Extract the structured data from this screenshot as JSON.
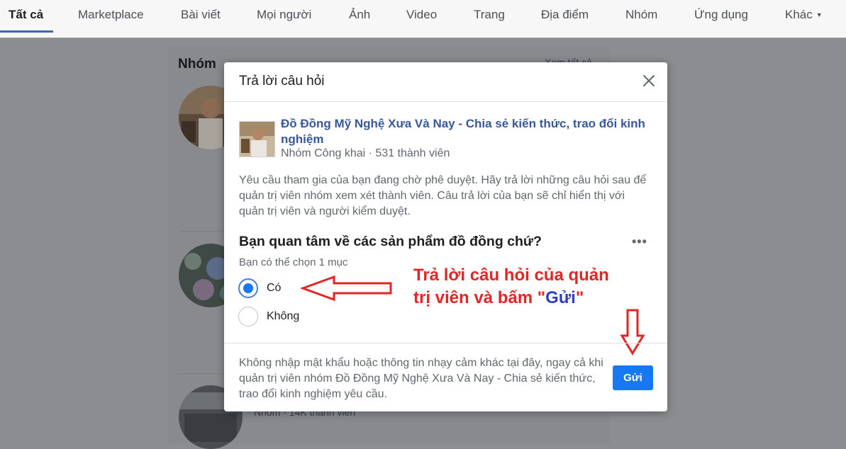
{
  "tabs": [
    {
      "label": "Tất cả",
      "active": true
    },
    {
      "label": "Marketplace"
    },
    {
      "label": "Bài viết"
    },
    {
      "label": "Mọi người"
    },
    {
      "label": "Ảnh"
    },
    {
      "label": "Video"
    },
    {
      "label": "Trang"
    },
    {
      "label": "Địa điểm"
    },
    {
      "label": "Nhóm"
    },
    {
      "label": "Ứng dụng"
    },
    {
      "label": "Khác"
    }
  ],
  "background": {
    "section_title": "Nhóm",
    "see_all": "Xem tất cả",
    "item3_meta": "Nhóm · 14K thành viên"
  },
  "dialog": {
    "title": "Trả lời câu hỏi",
    "group_name": "Đồ Đồng Mỹ Nghệ Xưa Và Nay - Chia sẻ kiến thức, trao đổi kinh nghiệm",
    "group_meta": "Nhóm Công khai · 531 thành viên",
    "notice": "Yêu cầu tham gia của bạn đang chờ phê duyệt. Hãy trả lời những câu hỏi sau để quản trị viên nhóm xem xét thành viên. Câu trả lời của bạn sẽ chỉ hiển thị với quản trị viên và người kiểm duyệt.",
    "question": "Bạn quan tâm về các sản phẩm đồ đồng chứ?",
    "hint": "Bạn có thể chọn 1 mục",
    "options": [
      {
        "label": "Có",
        "selected": true
      },
      {
        "label": "Không",
        "selected": false
      }
    ],
    "footer_text": "Không nhập mật khẩu hoặc thông tin nhạy cảm khác tại đây, ngay cả khi quản trị viên nhóm Đồ Đồng Mỹ Nghệ Xưa Và Nay - Chia sẻ kiến thức, trao đổi kinh nghiệm yêu cầu.",
    "send_label": "Gửi"
  },
  "annotation": {
    "line1": "Trả lời câu hỏi của quản",
    "line2_prefix": "trị viên và bấm \"",
    "line2_emph": "Gửi",
    "line2_suffix": "\""
  },
  "colors": {
    "accent": "#1877f2",
    "link": "#385898",
    "annotation": "#e32525",
    "annotation_emph": "#2f3fbf"
  },
  "icons": {
    "close": "close-icon",
    "more": "more-horizontal-icon",
    "caret": "caret-down-icon"
  }
}
